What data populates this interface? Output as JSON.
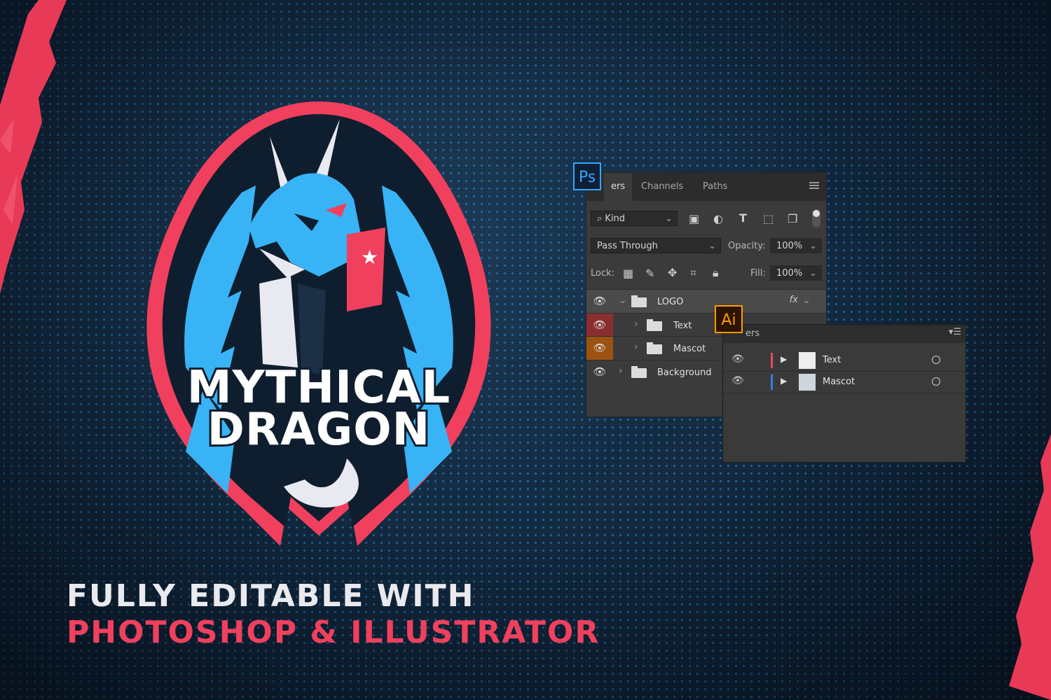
{
  "logo": {
    "line1": "MYTHICAL",
    "line2": "DRAGON"
  },
  "tagline": {
    "line1": "FULLY EDITABLE WITH",
    "line2": "PHOTOSHOP & ILLUSTRATOR"
  },
  "colors": {
    "accent_red": "#f0405e",
    "accent_blue": "#38b3f5",
    "bg_dark": "#132a40"
  },
  "photoshop": {
    "badge": "Ps",
    "tabs": [
      "ers",
      "Channels",
      "Paths"
    ],
    "filter_kind": "Kind",
    "blend_mode": "Pass Through",
    "opacity_label": "Opacity:",
    "opacity_value": "100%",
    "lock_label": "Lock:",
    "fill_label": "Fill:",
    "fill_value": "100%",
    "fx_label": "fx",
    "layers": [
      {
        "name": "LOGO",
        "type": "group-open"
      },
      {
        "name": "Text",
        "type": "group",
        "color": "red"
      },
      {
        "name": "Mascot",
        "type": "group",
        "color": "orange"
      },
      {
        "name": "Background",
        "type": "group"
      }
    ]
  },
  "illustrator": {
    "badge": "Ai",
    "header": "ers",
    "layers": [
      {
        "name": "Text",
        "color": "#e84a5f"
      },
      {
        "name": "Mascot",
        "color": "#3a7ee0"
      }
    ]
  }
}
